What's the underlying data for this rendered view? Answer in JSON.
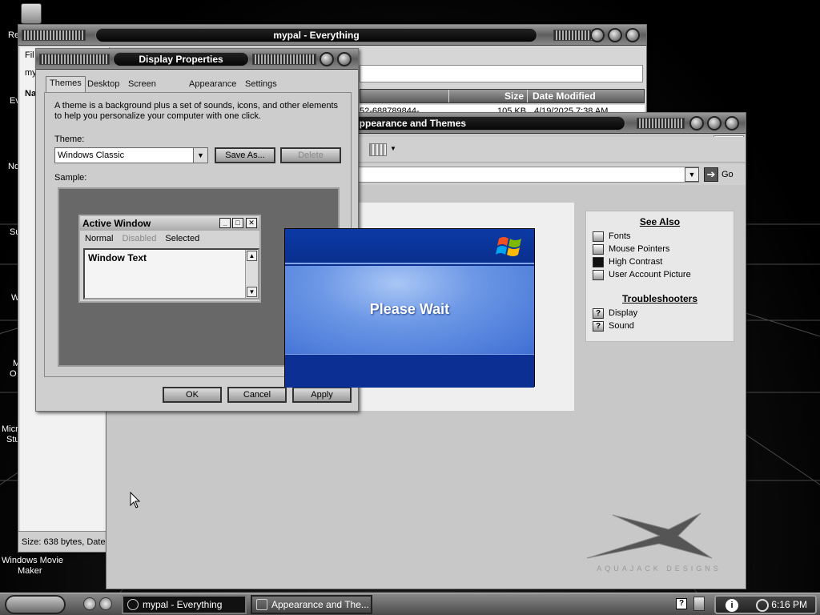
{
  "desktop": {
    "labels": [
      "Re",
      "Ev",
      "No",
      "Su",
      "W",
      "M",
      "O",
      "Micro",
      "Stu",
      "Windows Movie",
      "Maker"
    ]
  },
  "mypal": {
    "title": "mypal - Everything",
    "menu_first": "Fil",
    "addr_stub": "my",
    "left_stub_n": "Na",
    "columns": {
      "size": "Size",
      "date": "Date Modified"
    },
    "row": {
      "name": "52-688789844-...",
      "size": "105 KB",
      "date": "4/19/2025 7:38 AM"
    },
    "status": "Size: 638 bytes, Date"
  },
  "appearance": {
    "title": "Appearance and Themes",
    "go_label": "Go",
    "see_also": {
      "heading": "See Also",
      "items": [
        "Fonts",
        "Mouse Pointers",
        "High Contrast",
        "User Account Picture"
      ]
    },
    "troubleshooters": {
      "heading": "Troubleshooters",
      "items": [
        "Display",
        "Sound"
      ]
    },
    "logo_text": "AQUAJACK DESIGNS"
  },
  "display": {
    "title": "Display Properties",
    "tabs": [
      "Themes",
      "Desktop",
      "Screen Saver",
      "Appearance",
      "Settings"
    ],
    "description": "A theme is a background plus a set of sounds, icons, and other elements to help you personalize your computer with one click.",
    "theme_label": "Theme:",
    "theme_value": "Windows Classic",
    "save_as": "Save As...",
    "delete": "Delete",
    "sample_label": "Sample:",
    "sample": {
      "title": "Active Window",
      "menu": [
        "Normal",
        "Disabled",
        "Selected"
      ],
      "window_text": "Window Text"
    },
    "ok": "OK",
    "cancel": "Cancel",
    "apply": "Apply"
  },
  "splash": {
    "text": "Please Wait"
  },
  "taskbar": {
    "tasks": [
      "mypal - Everything",
      "Appearance and The..."
    ],
    "tray_help": "?",
    "tray_info": "i",
    "clock": "6:16 PM"
  }
}
